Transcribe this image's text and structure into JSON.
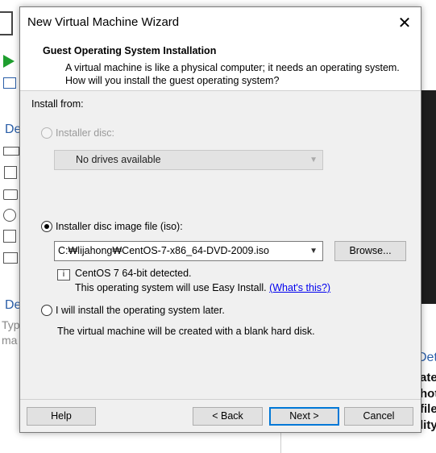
{
  "window": {
    "title": "New Virtual Machine Wizard",
    "close_glyph": "✕"
  },
  "header": {
    "title": "Guest Operating System Installation",
    "description": "A virtual machine is like a physical computer; it needs an operating system. How will you install the guest operating system?"
  },
  "install_from": {
    "label": "Install from:",
    "disc_option": {
      "label": "Installer disc:",
      "selected": false,
      "enabled": false,
      "dropdown_value": "No drives available"
    },
    "iso_option": {
      "label": "Installer disc image file (iso):",
      "selected": true,
      "path_value": "C:₩lijahong₩CentOS-7-x86_64-DVD-2009.iso",
      "browse_label": "Browse...",
      "detected_text": "CentOS 7 64-bit detected.",
      "easy_install_text": "This operating system will use Easy Install.",
      "whats_this_link": "(What's this?)",
      "info_icon": "info-icon"
    },
    "later_option": {
      "label": "I will install the operating system later.",
      "selected": false,
      "note": "The virtual machine will be created with a blank hard disk."
    }
  },
  "footer": {
    "help": "Help",
    "back": "< Back",
    "next": "Next >",
    "cancel": "Cancel"
  },
  "background": {
    "left_texts": [
      "De",
      "De",
      "Typ",
      "ma"
    ],
    "right_texts": [
      "Det",
      "ate",
      "hot",
      "file",
      "lity"
    ]
  },
  "colors": {
    "accent": "#0078d7",
    "link": "#0000ee",
    "play_green": "#1e9e2e"
  }
}
